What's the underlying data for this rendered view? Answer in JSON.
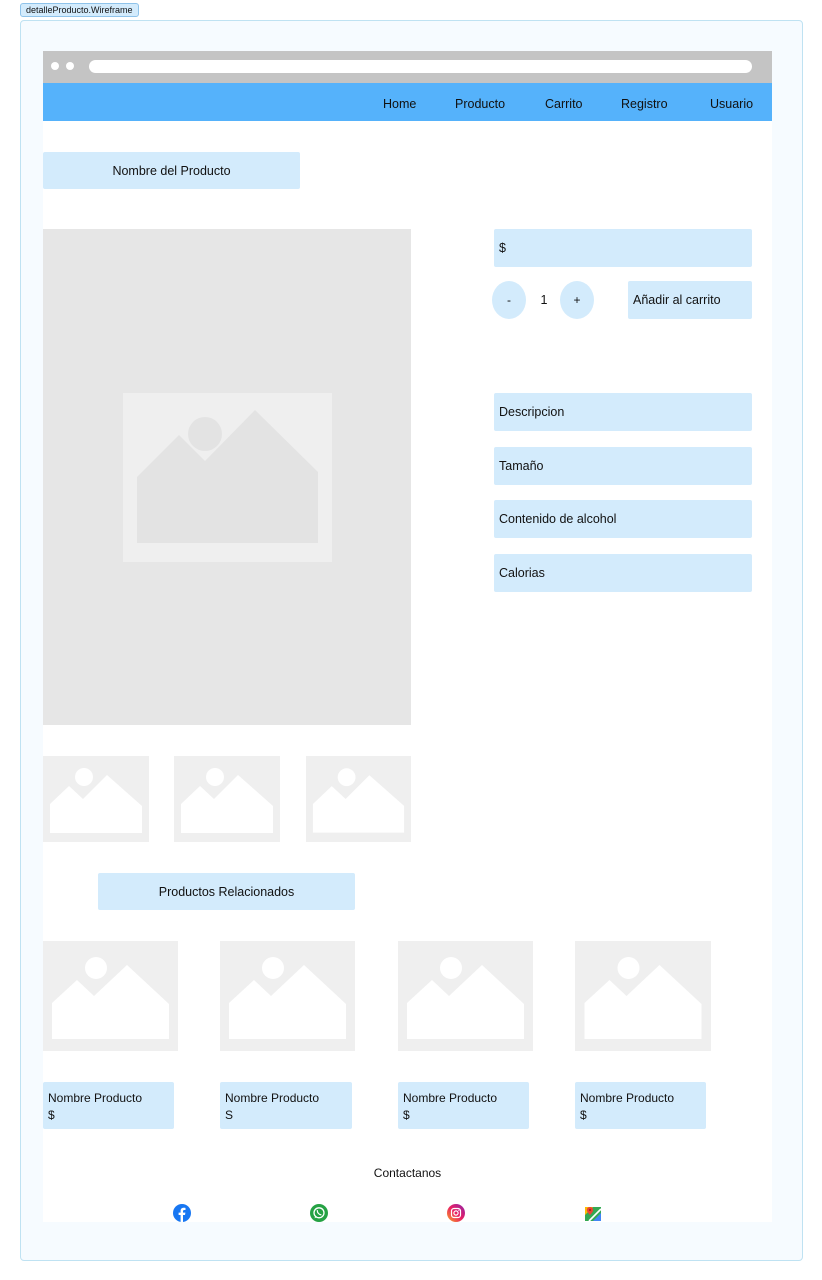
{
  "frame_label": "detalleProducto.Wireframe",
  "nav": {
    "items": [
      "Home",
      "Producto",
      "Carrito",
      "Registro",
      "Usuario"
    ]
  },
  "product": {
    "name_label": "Nombre del Producto",
    "price_label": "$",
    "qty_minus": "-",
    "qty_value": "1",
    "qty_plus": "+",
    "add_to_cart": "Añadir al carrito",
    "details": [
      "Descripcion",
      "Tamaño",
      "Contenido de alcohol",
      "Calorias"
    ]
  },
  "related": {
    "title": "Productos Relacionados",
    "items": [
      {
        "name": "Nombre Producto",
        "price": "$"
      },
      {
        "name": "Nombre Producto",
        "price": "S"
      },
      {
        "name": "Nombre Producto",
        "price": "$"
      },
      {
        "name": "Nombre Producto",
        "price": "$"
      }
    ]
  },
  "footer": {
    "contact_label": "Contactanos",
    "icons": [
      "facebook-icon",
      "whatsapp-icon",
      "instagram-icon",
      "maps-icon"
    ]
  },
  "colors": {
    "navbar": "#55b2fb",
    "box": "#d3ebfc",
    "browser_bar": "#c4c4c4",
    "placeholder": "#e6e6e6"
  }
}
